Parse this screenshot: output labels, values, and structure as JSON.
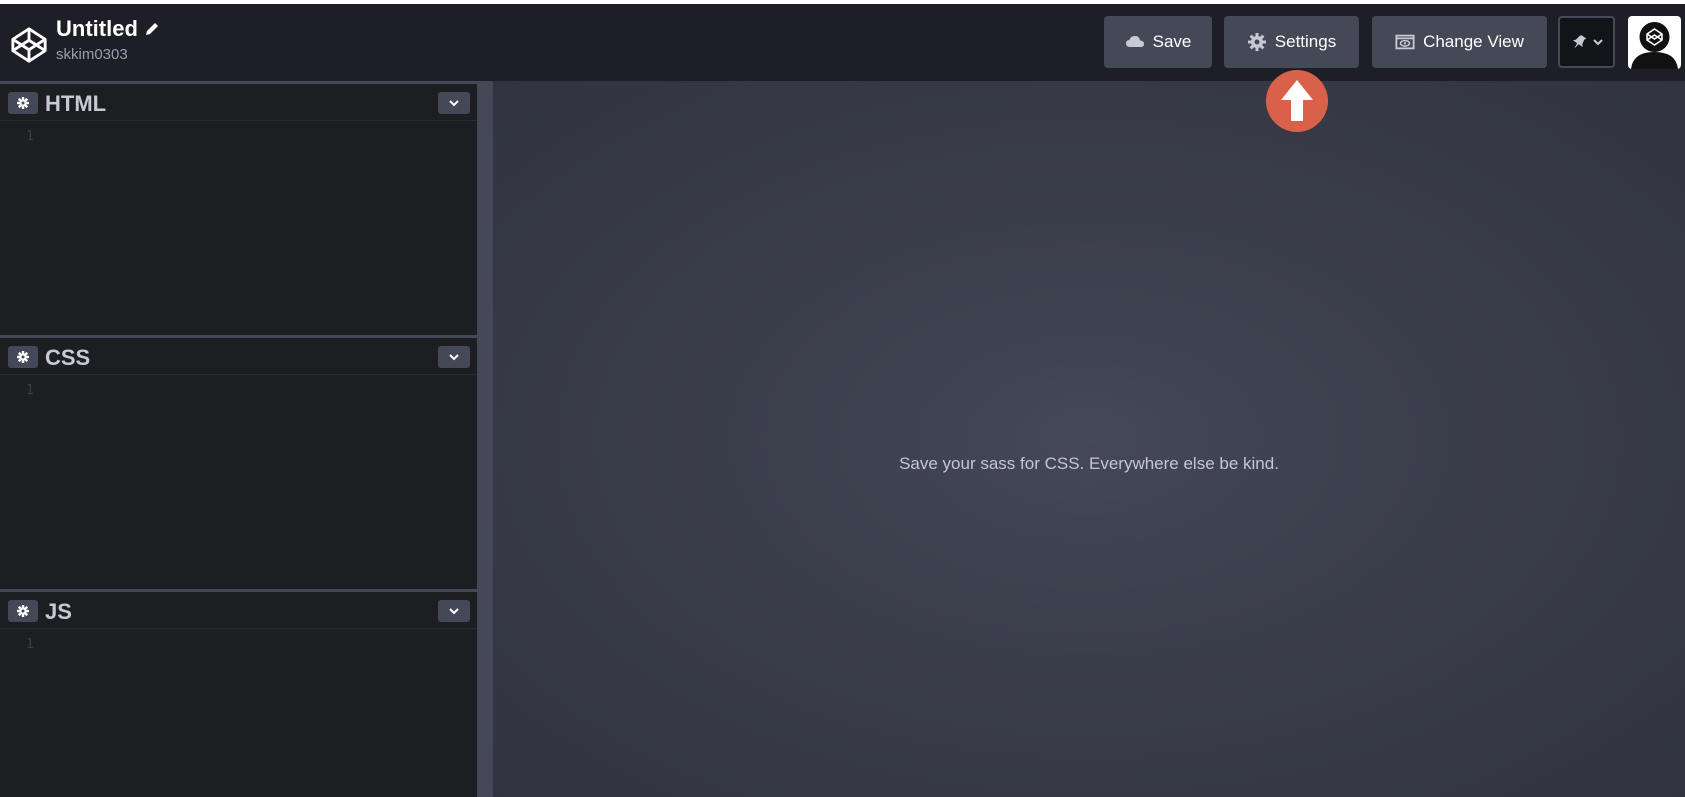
{
  "header": {
    "title": "Untitled",
    "username": "skkim0303",
    "buttons": {
      "save": "Save",
      "settings": "Settings",
      "change_view": "Change View"
    }
  },
  "editors": [
    {
      "name": "HTML",
      "line": "1"
    },
    {
      "name": "CSS",
      "line": "1"
    },
    {
      "name": "JS",
      "line": "1"
    }
  ],
  "preview": {
    "message": "Save your sass for CSS. Everywhere else be kind."
  },
  "colors": {
    "header_bg": "#1e1f26",
    "button_bg": "#444857",
    "editor_bg": "#1d1e22",
    "annotation_arrow": "#d9614a"
  },
  "icons": [
    "codepen-logo-icon",
    "pencil-icon",
    "cloud-icon",
    "gear-icon",
    "eye-icon",
    "pin-icon",
    "chevron-down-icon",
    "avatar-icon",
    "up-arrow-annotation-icon"
  ]
}
